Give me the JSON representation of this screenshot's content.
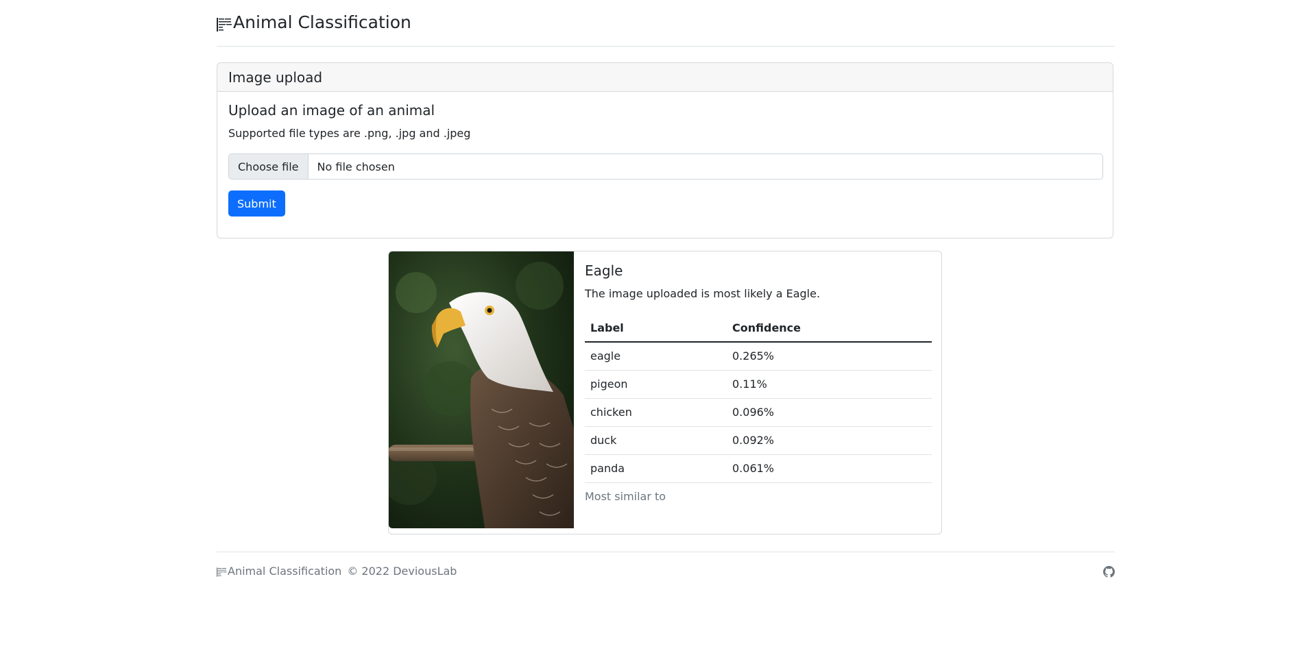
{
  "header": {
    "brand_title": "Animal Classification",
    "brand_icon": "grid-lines-icon"
  },
  "upload": {
    "card_header": "Image upload",
    "title": "Upload an image of an animal",
    "subtitle": "Supported file types are .png, .jpg and .jpeg",
    "choose_file_label": "Choose file",
    "file_status": "No file chosen",
    "submit_label": "Submit"
  },
  "result": {
    "image_alt": "Bald eagle photo",
    "title": "Eagle",
    "description": "The image uploaded is most likely a Eagle.",
    "table": {
      "columns": [
        "Label",
        "Confidence"
      ],
      "rows": [
        {
          "label": "eagle",
          "confidence": "0.265%"
        },
        {
          "label": "pigeon",
          "confidence": "0.11%"
        },
        {
          "label": "chicken",
          "confidence": "0.096%"
        },
        {
          "label": "duck",
          "confidence": "0.092%"
        },
        {
          "label": "panda",
          "confidence": "0.061%"
        }
      ]
    },
    "footer_text": "Most similar to"
  },
  "footer": {
    "brand_title": "Animal Classification",
    "copyright": "© 2022 DeviousLab",
    "github_icon": "github-icon"
  },
  "colors": {
    "primary": "#0d6efd",
    "muted": "#6c757d",
    "border": "#dee2e6"
  }
}
